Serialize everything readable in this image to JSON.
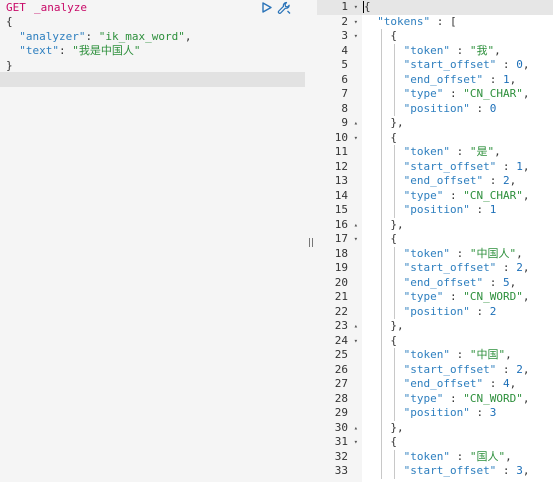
{
  "request": {
    "method": "GET",
    "path": "_analyze",
    "body_lines": [
      {
        "parts": [
          [
            "p",
            "{"
          ]
        ]
      },
      {
        "parts": [
          [
            "p",
            "  "
          ],
          [
            "k",
            "\"analyzer\""
          ],
          [
            "p",
            ": "
          ],
          [
            "s",
            "\"ik_max_word\""
          ],
          [
            "p",
            ","
          ]
        ]
      },
      {
        "parts": [
          [
            "p",
            "  "
          ],
          [
            "k",
            "\"text\""
          ],
          [
            "p",
            ": "
          ],
          [
            "s",
            "\"我是中国人\""
          ]
        ]
      },
      {
        "parts": [
          [
            "p",
            "}"
          ]
        ]
      }
    ],
    "run_icon": "play-icon",
    "settings_icon": "wrench-icon"
  },
  "response": {
    "lines": [
      {
        "no": "1",
        "fold": "▾",
        "indent": 0,
        "parts": [
          [
            "p",
            "{"
          ]
        ]
      },
      {
        "no": "2",
        "fold": "▾",
        "indent": 1,
        "parts": [
          [
            "k",
            "\"tokens\""
          ],
          [
            "p",
            " : ["
          ]
        ]
      },
      {
        "no": "3",
        "fold": "▾",
        "indent": 2,
        "parts": [
          [
            "p",
            "{"
          ]
        ]
      },
      {
        "no": "4",
        "fold": "",
        "indent": 3,
        "parts": [
          [
            "k",
            "\"token\""
          ],
          [
            "p",
            " : "
          ],
          [
            "s",
            "\"我\""
          ],
          [
            "p",
            ","
          ]
        ]
      },
      {
        "no": "5",
        "fold": "",
        "indent": 3,
        "parts": [
          [
            "k",
            "\"start_offset\""
          ],
          [
            "p",
            " : "
          ],
          [
            "n",
            "0"
          ],
          [
            "p",
            ","
          ]
        ]
      },
      {
        "no": "6",
        "fold": "",
        "indent": 3,
        "parts": [
          [
            "k",
            "\"end_offset\""
          ],
          [
            "p",
            " : "
          ],
          [
            "n",
            "1"
          ],
          [
            "p",
            ","
          ]
        ]
      },
      {
        "no": "7",
        "fold": "",
        "indent": 3,
        "parts": [
          [
            "k",
            "\"type\""
          ],
          [
            "p",
            " : "
          ],
          [
            "s",
            "\"CN_CHAR\""
          ],
          [
            "p",
            ","
          ]
        ]
      },
      {
        "no": "8",
        "fold": "",
        "indent": 3,
        "parts": [
          [
            "k",
            "\"position\""
          ],
          [
            "p",
            " : "
          ],
          [
            "n",
            "0"
          ]
        ]
      },
      {
        "no": "9",
        "fold": "▴",
        "indent": 2,
        "parts": [
          [
            "p",
            "},"
          ]
        ]
      },
      {
        "no": "10",
        "fold": "▾",
        "indent": 2,
        "parts": [
          [
            "p",
            "{"
          ]
        ]
      },
      {
        "no": "11",
        "fold": "",
        "indent": 3,
        "parts": [
          [
            "k",
            "\"token\""
          ],
          [
            "p",
            " : "
          ],
          [
            "s",
            "\"是\""
          ],
          [
            "p",
            ","
          ]
        ]
      },
      {
        "no": "12",
        "fold": "",
        "indent": 3,
        "parts": [
          [
            "k",
            "\"start_offset\""
          ],
          [
            "p",
            " : "
          ],
          [
            "n",
            "1"
          ],
          [
            "p",
            ","
          ]
        ]
      },
      {
        "no": "13",
        "fold": "",
        "indent": 3,
        "parts": [
          [
            "k",
            "\"end_offset\""
          ],
          [
            "p",
            " : "
          ],
          [
            "n",
            "2"
          ],
          [
            "p",
            ","
          ]
        ]
      },
      {
        "no": "14",
        "fold": "",
        "indent": 3,
        "parts": [
          [
            "k",
            "\"type\""
          ],
          [
            "p",
            " : "
          ],
          [
            "s",
            "\"CN_CHAR\""
          ],
          [
            "p",
            ","
          ]
        ]
      },
      {
        "no": "15",
        "fold": "",
        "indent": 3,
        "parts": [
          [
            "k",
            "\"position\""
          ],
          [
            "p",
            " : "
          ],
          [
            "n",
            "1"
          ]
        ]
      },
      {
        "no": "16",
        "fold": "▴",
        "indent": 2,
        "parts": [
          [
            "p",
            "},"
          ]
        ]
      },
      {
        "no": "17",
        "fold": "▾",
        "indent": 2,
        "parts": [
          [
            "p",
            "{"
          ]
        ]
      },
      {
        "no": "18",
        "fold": "",
        "indent": 3,
        "parts": [
          [
            "k",
            "\"token\""
          ],
          [
            "p",
            " : "
          ],
          [
            "s",
            "\"中国人\""
          ],
          [
            "p",
            ","
          ]
        ]
      },
      {
        "no": "19",
        "fold": "",
        "indent": 3,
        "parts": [
          [
            "k",
            "\"start_offset\""
          ],
          [
            "p",
            " : "
          ],
          [
            "n",
            "2"
          ],
          [
            "p",
            ","
          ]
        ]
      },
      {
        "no": "20",
        "fold": "",
        "indent": 3,
        "parts": [
          [
            "k",
            "\"end_offset\""
          ],
          [
            "p",
            " : "
          ],
          [
            "n",
            "5"
          ],
          [
            "p",
            ","
          ]
        ]
      },
      {
        "no": "21",
        "fold": "",
        "indent": 3,
        "parts": [
          [
            "k",
            "\"type\""
          ],
          [
            "p",
            " : "
          ],
          [
            "s",
            "\"CN_WORD\""
          ],
          [
            "p",
            ","
          ]
        ]
      },
      {
        "no": "22",
        "fold": "",
        "indent": 3,
        "parts": [
          [
            "k",
            "\"position\""
          ],
          [
            "p",
            " : "
          ],
          [
            "n",
            "2"
          ]
        ]
      },
      {
        "no": "23",
        "fold": "▴",
        "indent": 2,
        "parts": [
          [
            "p",
            "},"
          ]
        ]
      },
      {
        "no": "24",
        "fold": "▾",
        "indent": 2,
        "parts": [
          [
            "p",
            "{"
          ]
        ]
      },
      {
        "no": "25",
        "fold": "",
        "indent": 3,
        "parts": [
          [
            "k",
            "\"token\""
          ],
          [
            "p",
            " : "
          ],
          [
            "s",
            "\"中国\""
          ],
          [
            "p",
            ","
          ]
        ]
      },
      {
        "no": "26",
        "fold": "",
        "indent": 3,
        "parts": [
          [
            "k",
            "\"start_offset\""
          ],
          [
            "p",
            " : "
          ],
          [
            "n",
            "2"
          ],
          [
            "p",
            ","
          ]
        ]
      },
      {
        "no": "27",
        "fold": "",
        "indent": 3,
        "parts": [
          [
            "k",
            "\"end_offset\""
          ],
          [
            "p",
            " : "
          ],
          [
            "n",
            "4"
          ],
          [
            "p",
            ","
          ]
        ]
      },
      {
        "no": "28",
        "fold": "",
        "indent": 3,
        "parts": [
          [
            "k",
            "\"type\""
          ],
          [
            "p",
            " : "
          ],
          [
            "s",
            "\"CN_WORD\""
          ],
          [
            "p",
            ","
          ]
        ]
      },
      {
        "no": "29",
        "fold": "",
        "indent": 3,
        "parts": [
          [
            "k",
            "\"position\""
          ],
          [
            "p",
            " : "
          ],
          [
            "n",
            "3"
          ]
        ]
      },
      {
        "no": "30",
        "fold": "▴",
        "indent": 2,
        "parts": [
          [
            "p",
            "},"
          ]
        ]
      },
      {
        "no": "31",
        "fold": "▾",
        "indent": 2,
        "parts": [
          [
            "p",
            "{"
          ]
        ]
      },
      {
        "no": "32",
        "fold": "",
        "indent": 3,
        "parts": [
          [
            "k",
            "\"token\""
          ],
          [
            "p",
            " : "
          ],
          [
            "s",
            "\"国人\""
          ],
          [
            "p",
            ","
          ]
        ]
      },
      {
        "no": "33",
        "fold": "",
        "indent": 3,
        "parts": [
          [
            "k",
            "\"start_offset\""
          ],
          [
            "p",
            " : "
          ],
          [
            "n",
            "3"
          ],
          [
            "p",
            ","
          ]
        ]
      }
    ]
  },
  "colors": {
    "method": "#c80a68",
    "key": "#2e7fbf",
    "string": "#2c8f3b",
    "number": "#1c6fb8",
    "icon": "#2a73b8"
  }
}
